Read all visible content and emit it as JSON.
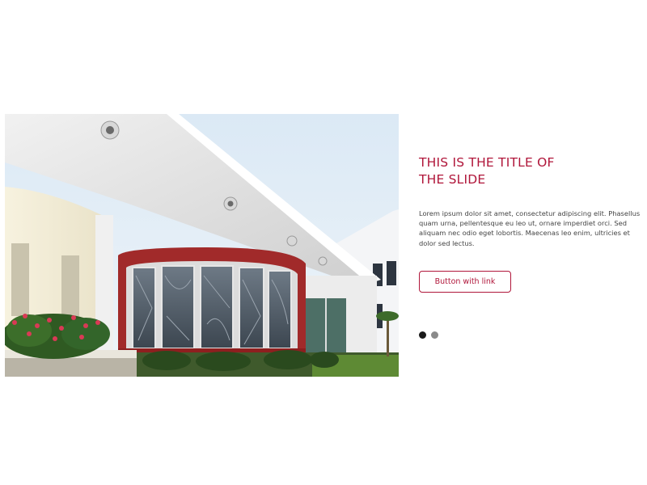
{
  "slide": {
    "image": {
      "description_icon": "building-photo"
    },
    "title": "THIS IS THE TITLE OF THE SLIDE",
    "text": "Lorem ipsum dolor sit amet, consectetur adipiscing elit. Phasellus quam urna, pellentesque eu leo ut, ornare imperdiet orci. Sed aliquam nec odio eget lobortis. Maecenas leo enim, ultricies et dolor sed lectus.",
    "button_label": "Button with link"
  },
  "pagination": {
    "count": 2,
    "active_index": 0
  },
  "colors": {
    "accent": "#b0163a",
    "text": "#444444",
    "dot_active": "#1a1a1a",
    "dot_inactive": "#8a8a8a"
  }
}
